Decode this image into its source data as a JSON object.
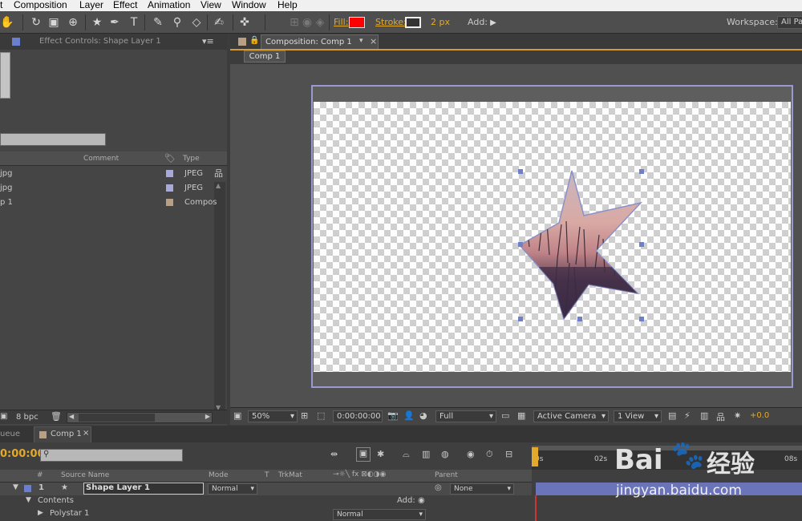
{
  "menu": [
    "t",
    "Composition",
    "Layer",
    "Effect",
    "Animation",
    "View",
    "Window",
    "Help"
  ],
  "toolbar": {
    "fill_label": "Fill:",
    "fill_color": "#ff0000",
    "stroke_label": "Stroke:",
    "stroke_width": "2 px",
    "add_label": "Add:",
    "workspace_label": "Workspace:",
    "workspace_value": "All Pa"
  },
  "left_panel": {
    "tab": "Effect Controls: Shape Layer 1",
    "col_comment": "Comment",
    "col_type": "Type",
    "rows": [
      {
        "name": "jpg",
        "type": "JPEG",
        "color": "#a9a9d8"
      },
      {
        "name": "jpg",
        "type": "JPEG",
        "color": "#a9a9d8"
      },
      {
        "name": "p 1",
        "type": "Compos",
        "color": "#b7a083"
      }
    ],
    "bpc": "8 bpc"
  },
  "viewer": {
    "tab": "Composition: Comp 1",
    "crumb": "Comp 1",
    "zoom": "50%",
    "timecode": "0:00:00:00",
    "resolution": "Full",
    "camera": "Active Camera",
    "views": "1 View",
    "exposure": "+0.0"
  },
  "timeline": {
    "tab_queue": "ueue",
    "tab_comp": "Comp 1",
    "time": "0:00:00",
    "cols": {
      "num": "#",
      "source": "Source Name",
      "mode": "Mode",
      "t": "T",
      "trkmat": "TrkMat",
      "parent": "Parent"
    },
    "layer": {
      "num": "1",
      "name": "Shape Layer 1",
      "mode": "Normal",
      "parent": "None"
    },
    "contents": "Contents",
    "add_label": "Add:",
    "polystar": "Polystar 1",
    "polystar_mode": "Normal",
    "ruler": [
      "0s",
      "02s",
      "08s"
    ]
  },
  "watermark": {
    "brand": "Bai",
    "brand2": "经验",
    "url": "jingyan.baidu.com"
  }
}
